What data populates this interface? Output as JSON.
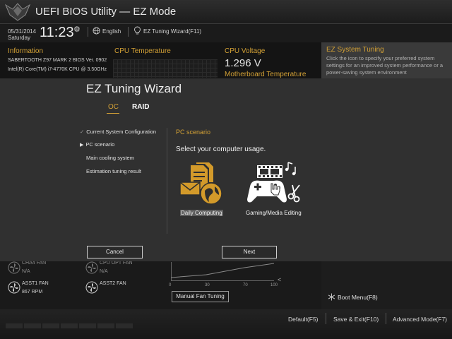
{
  "header": {
    "title": "UEFI BIOS Utility — EZ Mode",
    "date": "05/31/2014",
    "day": "Saturday",
    "time": "11:23",
    "language": "English",
    "ez_tuning_wizard": "EZ Tuning Wizard(F11)"
  },
  "information": {
    "title": "Information",
    "board": "SABERTOOTH Z97 MARK 2   BIOS Ver. 0902",
    "cpu": "Intel(R) Core(TM) i7-4770K CPU @ 3.50GHz"
  },
  "cpu_temperature": {
    "title": "CPU Temperature"
  },
  "cpu_voltage": {
    "title": "CPU Voltage",
    "value": "1.296 V",
    "next_title": "Motherboard Temperature"
  },
  "ez_system_tuning": {
    "title": "EZ System Tuning",
    "description": "Click the icon to specify your preferred system settings for an improved system performance or a power-saving system environment"
  },
  "wizard": {
    "title": "EZ Tuning Wizard",
    "tabs": [
      {
        "label": "OC",
        "active": true
      },
      {
        "label": "RAID",
        "active": false
      }
    ],
    "steps": [
      {
        "marker": "✓",
        "label": "Current System Configuration"
      },
      {
        "marker": "▶",
        "label": "PC scenario"
      },
      {
        "marker": "",
        "label": "Main cooling system"
      },
      {
        "marker": "",
        "label": "Estimation tuning result"
      }
    ],
    "section_title": "PC scenario",
    "prompt": "Select your computer usage.",
    "options": [
      {
        "label": "Daily Computing",
        "icon": "daily-computing-icon",
        "selected": true
      },
      {
        "label": "Gaming/Media Editing",
        "icon": "gaming-media-icon",
        "selected": false
      }
    ],
    "cancel_label": "Cancel",
    "next_label": "Next"
  },
  "fans": [
    {
      "name": "CHA4 FAN",
      "value": "N/A"
    },
    {
      "name": "CPU OPT FAN",
      "value": "N/A"
    },
    {
      "name": "ASST1 FAN",
      "value": "867 RPM"
    },
    {
      "name": "ASST2 FAN",
      "value": ""
    }
  ],
  "fan_graph": {
    "ticks": [
      "0",
      "30",
      "70",
      "100"
    ]
  },
  "manual_fan_tuning": "Manual Fan Tuning",
  "boot_menu": "Boot Menu(F8)",
  "footer": {
    "default": "Default(F5)",
    "save_exit": "Save & Exit(F10)",
    "advanced": "Advanced Mode(F7)"
  },
  "colors": {
    "accent": "#d2a035",
    "modal_bg": "#303030",
    "page_bg": "#141414"
  }
}
